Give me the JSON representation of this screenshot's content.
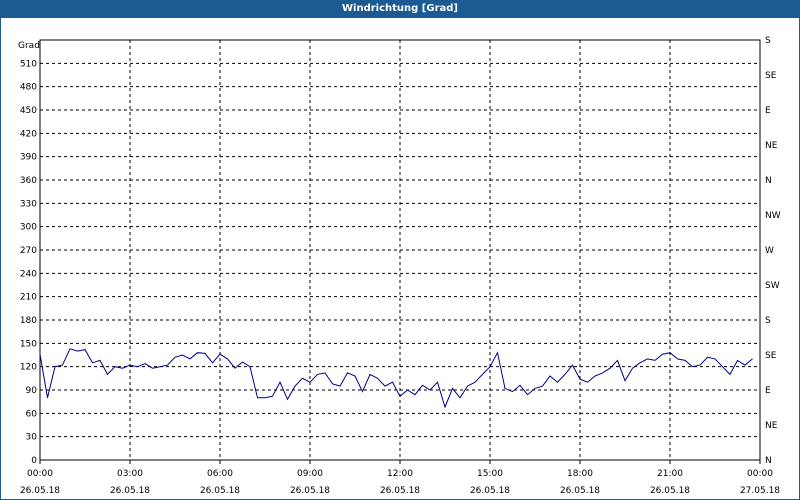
{
  "window": {
    "title": "Windrichtung [Grad]"
  },
  "chart_data": {
    "type": "line",
    "title": "Windrichtung [Grad]",
    "ylabel": "Grad",
    "ylim": [
      0,
      540
    ],
    "y_ticks": [
      0,
      30,
      60,
      90,
      120,
      150,
      180,
      210,
      240,
      270,
      300,
      330,
      360,
      390,
      420,
      450,
      480,
      510
    ],
    "xlim": [
      "26.05.18 00:00",
      "27.05.18 00:00"
    ],
    "x_ticks": [
      {
        "time": "00:00",
        "date": "26.05.18"
      },
      {
        "time": "03:00",
        "date": "26.05.18"
      },
      {
        "time": "06:00",
        "date": "26.05.18"
      },
      {
        "time": "09:00",
        "date": "26.05.18"
      },
      {
        "time": "12:00",
        "date": "26.05.18"
      },
      {
        "time": "15:00",
        "date": "26.05.18"
      },
      {
        "time": "18:00",
        "date": "26.05.18"
      },
      {
        "time": "21:00",
        "date": "26.05.18"
      },
      {
        "time": "00:00",
        "date": "27.05.18"
      }
    ],
    "right_axis": {
      "ticks": [
        {
          "value": 0,
          "label": "N"
        },
        {
          "value": 45,
          "label": "NE"
        },
        {
          "value": 90,
          "label": "E"
        },
        {
          "value": 135,
          "label": "SE"
        },
        {
          "value": 180,
          "label": "S"
        },
        {
          "value": 225,
          "label": "SW"
        },
        {
          "value": 270,
          "label": "W"
        },
        {
          "value": 315,
          "label": "NW"
        },
        {
          "value": 360,
          "label": "N"
        },
        {
          "value": 405,
          "label": "NE"
        },
        {
          "value": 450,
          "label": "E"
        },
        {
          "value": 495,
          "label": "SE"
        },
        {
          "value": 540,
          "label": "S"
        }
      ]
    },
    "grid": true,
    "line_color": "#00008b",
    "x": [
      "00:00",
      "00:15",
      "00:30",
      "00:45",
      "01:00",
      "01:15",
      "01:30",
      "01:45",
      "02:00",
      "02:15",
      "02:30",
      "02:45",
      "03:00",
      "03:15",
      "03:30",
      "03:45",
      "04:00",
      "04:15",
      "04:30",
      "04:45",
      "05:00",
      "05:15",
      "05:30",
      "05:45",
      "06:00",
      "06:15",
      "06:30",
      "06:45",
      "07:00",
      "07:15",
      "07:30",
      "07:45",
      "08:00",
      "08:15",
      "08:30",
      "08:45",
      "09:00",
      "09:15",
      "09:30",
      "09:45",
      "10:00",
      "10:15",
      "10:30",
      "10:45",
      "11:00",
      "11:15",
      "11:30",
      "11:45",
      "12:00",
      "12:15",
      "12:30",
      "12:45",
      "13:00",
      "13:15",
      "13:30",
      "13:45",
      "14:00",
      "14:15",
      "14:30",
      "14:45",
      "15:00",
      "15:15",
      "15:30",
      "15:45",
      "16:00",
      "16:15",
      "16:30",
      "16:45",
      "17:00",
      "17:15",
      "17:30",
      "17:45",
      "18:00",
      "18:15",
      "18:30",
      "18:45",
      "19:00",
      "19:15",
      "19:30",
      "19:45",
      "20:00",
      "20:15",
      "20:30",
      "20:45",
      "21:00",
      "21:15",
      "21:30",
      "21:45",
      "22:00",
      "22:15",
      "22:30",
      "22:45",
      "23:00",
      "23:15",
      "23:30",
      "23:45"
    ],
    "series": [
      {
        "values": [
          136,
          80,
          120,
          122,
          143,
          140,
          142,
          125,
          128,
          110,
          120,
          118,
          122,
          120,
          124,
          118,
          120,
          122,
          132,
          135,
          130,
          138,
          137,
          125,
          136,
          130,
          118,
          126,
          120,
          80,
          80,
          82,
          100,
          78,
          95,
          105,
          100,
          110,
          112,
          98,
          95,
          112,
          108,
          88,
          110,
          105,
          95,
          100,
          82,
          90,
          84,
          96,
          90,
          100,
          68,
          92,
          80,
          95,
          100,
          110,
          120,
          138,
          92,
          88,
          96,
          84,
          92,
          95,
          108,
          100,
          110,
          122,
          104,
          100,
          108,
          112,
          118,
          128,
          102,
          118,
          125,
          130,
          128,
          136,
          138,
          130,
          128,
          120,
          122,
          132,
          130,
          120,
          110,
          128,
          122,
          130
        ]
      }
    ]
  }
}
